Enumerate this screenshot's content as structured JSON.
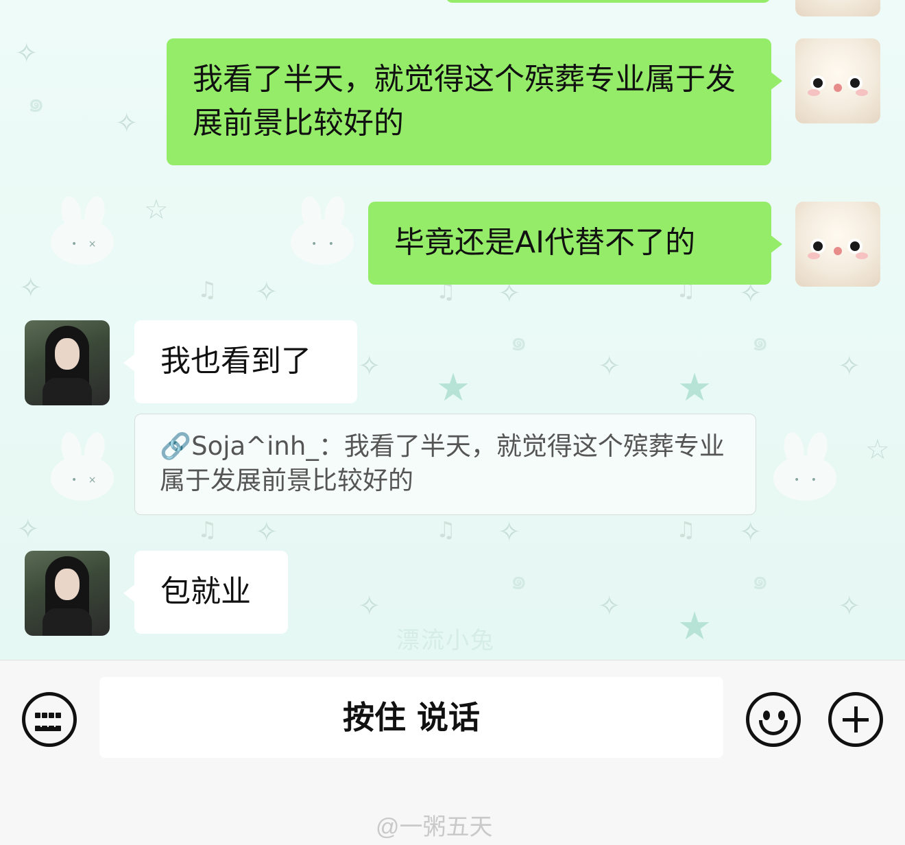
{
  "messages": [
    {
      "side": "right",
      "text": "我看了半天，就觉得这个殡葬专业属于发展前景比较好的"
    },
    {
      "side": "right",
      "text": "毕竟还是AI代替不了的"
    },
    {
      "side": "left",
      "text": "我也看到了"
    },
    {
      "side": "left",
      "text": "包就业"
    }
  ],
  "quote": {
    "icon": "🔗",
    "text": "Soja^inh_：我看了半天，就觉得这个殡葬专业属于发展前景比较好的"
  },
  "background_watermark": "漂流小兔",
  "input_bar": {
    "hold_to_talk_label": "按住 说话",
    "icons": [
      "keyboard-icon",
      "emoji-icon",
      "plus-icon"
    ]
  },
  "image_watermark": "@一粥五天",
  "colors": {
    "my_bubble": "#95ec69",
    "their_bubble": "#ffffff",
    "wallpaper": "#e9f8f4",
    "input_bar": "#f7f7f7"
  }
}
